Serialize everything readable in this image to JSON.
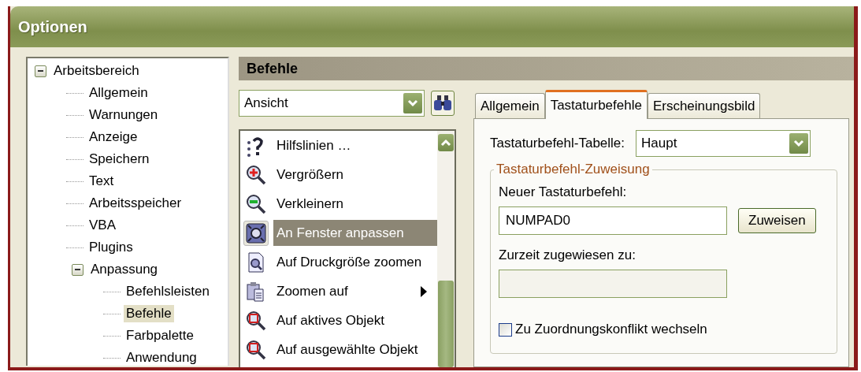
{
  "window": {
    "title": "Optionen"
  },
  "tree": [
    {
      "label": "Arbeitsbereich",
      "expanded": true,
      "selected": false,
      "children": [
        {
          "label": "Allgemein",
          "selected": false
        },
        {
          "label": "Warnungen",
          "selected": false
        },
        {
          "label": "Anzeige",
          "selected": false
        },
        {
          "label": "Speichern",
          "selected": false
        },
        {
          "label": "Text",
          "selected": false
        },
        {
          "label": "Arbeitsspeicher",
          "selected": false
        },
        {
          "label": "VBA",
          "selected": false
        },
        {
          "label": "Plugins",
          "selected": false
        },
        {
          "label": "Anpassung",
          "expanded": true,
          "selected": false,
          "children": [
            {
              "label": "Befehlsleisten",
              "selected": false
            },
            {
              "label": "Befehle",
              "selected": true
            },
            {
              "label": "Farbpalette",
              "selected": false
            },
            {
              "label": "Anwendung",
              "selected": false
            }
          ]
        }
      ]
    }
  ],
  "section_title": "Befehle",
  "category_dropdown": {
    "value": "Ansicht"
  },
  "commands": [
    {
      "label": "Hilfslinien …",
      "selected": false,
      "submenu": false
    },
    {
      "label": "Vergrößern",
      "selected": false,
      "submenu": false
    },
    {
      "label": "Verkleinern",
      "selected": false,
      "submenu": false
    },
    {
      "label": "An Fenster anpassen",
      "selected": true,
      "submenu": false
    },
    {
      "label": "Auf Druckgröße zoomen",
      "selected": false,
      "submenu": false
    },
    {
      "label": "Zoomen auf",
      "selected": false,
      "submenu": true
    },
    {
      "label": "Auf aktives Objekt",
      "selected": false,
      "submenu": false
    },
    {
      "label": "Auf ausgewählte Objekt",
      "selected": false,
      "submenu": false
    }
  ],
  "tabs": [
    {
      "label": "Allgemein",
      "selected": false
    },
    {
      "label": "Tastaturbefehle",
      "selected": true
    },
    {
      "label": "Erscheinungsbild",
      "selected": false
    }
  ],
  "table_label": "Tastaturbefehl-Tabelle:",
  "table_dropdown": {
    "value": "Haupt"
  },
  "group_title": "Tastaturbefehl-Zuweisung",
  "new_shortcut_label": "Neuer Tastaturbefehl:",
  "new_shortcut": {
    "value": "NUMPAD0"
  },
  "assign_button": "Zuweisen",
  "current_label": "Zurzeit zugewiesen zu:",
  "current_value": {
    "disabled": true
  },
  "conflict_checkbox": {
    "label": "Zu Zuordnungskonflikt wechseln",
    "checked": false
  }
}
